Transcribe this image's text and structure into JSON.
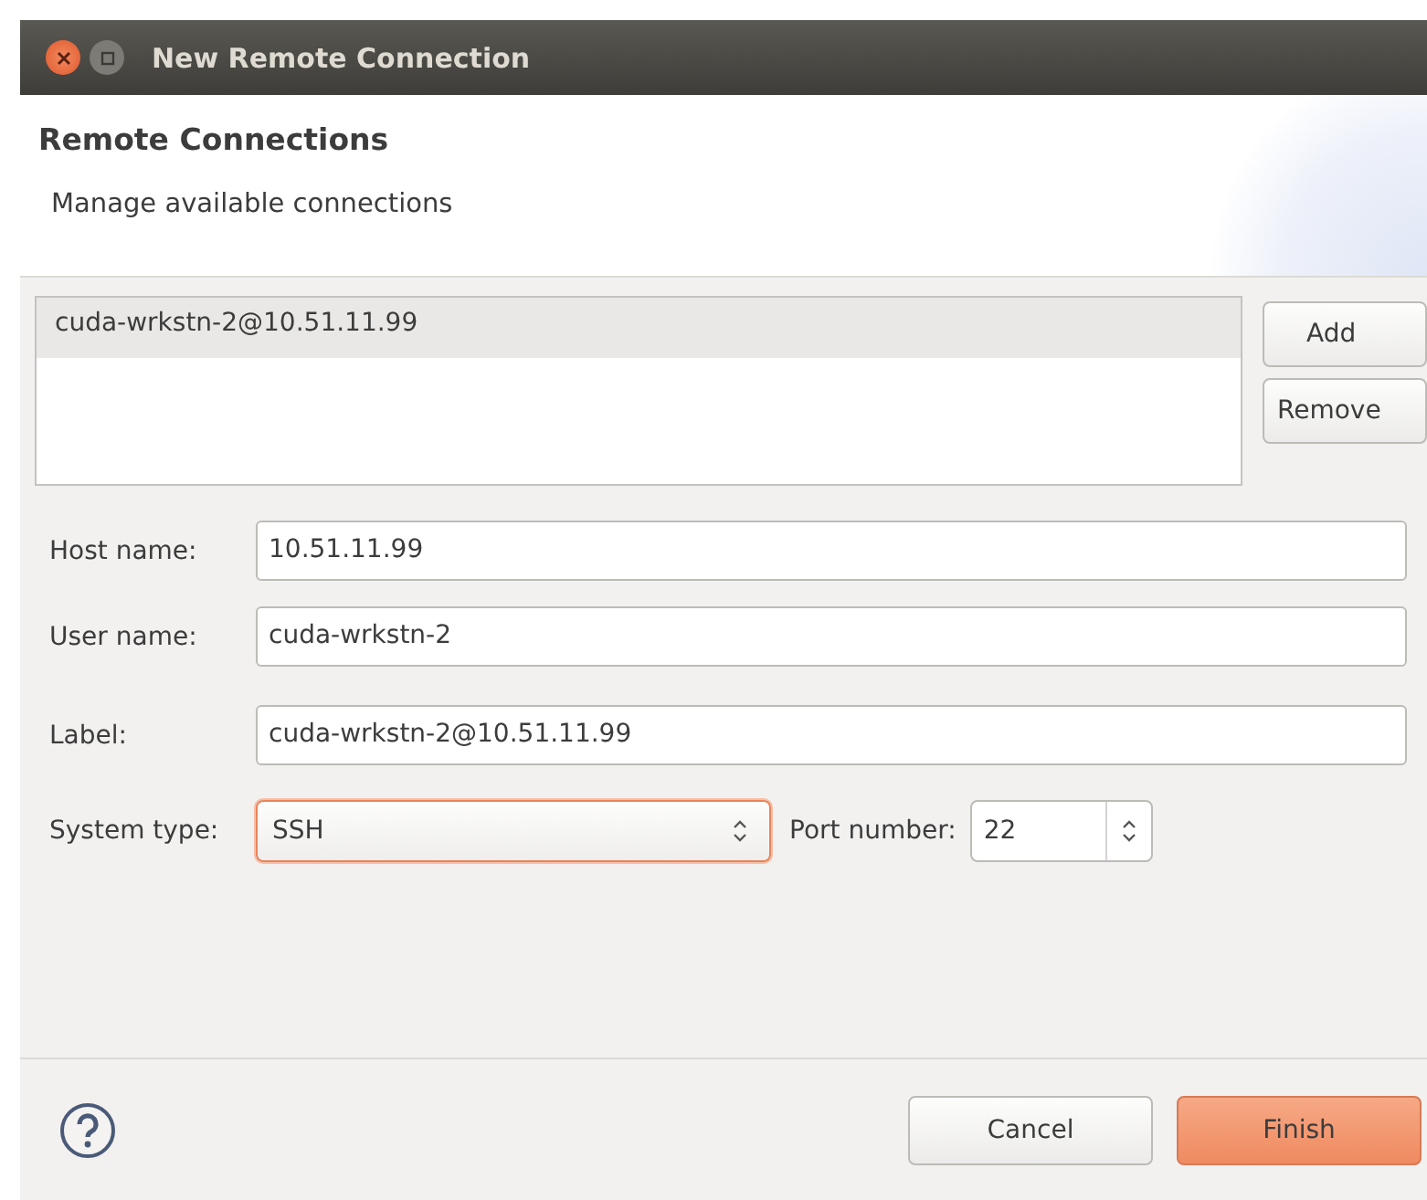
{
  "window": {
    "title": "New Remote Connection"
  },
  "header": {
    "title": "Remote Connections",
    "description": "Manage available connections"
  },
  "connections": [
    {
      "label": "cuda-wrkstn-2@10.51.11.99",
      "selected": true
    }
  ],
  "list_buttons": [
    "Add",
    "Remove"
  ],
  "fields": [
    {
      "kind": "text",
      "label": "Host name:",
      "value": "10.51.11.99"
    },
    {
      "kind": "text",
      "label": "User name:",
      "value": "cuda-wrkstn-2"
    },
    {
      "kind": "text",
      "label": "Label:",
      "value": "cuda-wrkstn-2@10.51.11.99"
    },
    {
      "kind": "select",
      "label": "System type:",
      "value": "SSH",
      "focused": true,
      "port": {
        "label": "Port number:",
        "value": "22"
      }
    }
  ],
  "footer_buttons": [
    {
      "label": "Cancel",
      "primary": false
    },
    {
      "label": "Finish",
      "primary": true
    }
  ]
}
